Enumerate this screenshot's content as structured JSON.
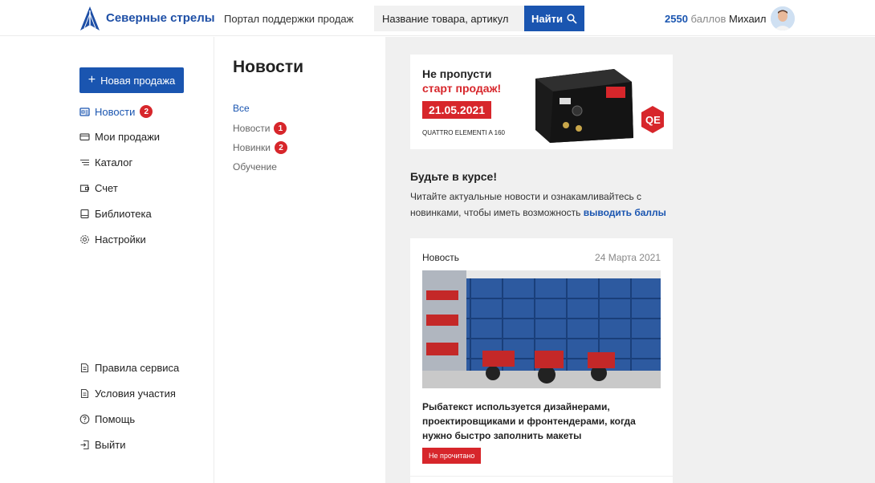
{
  "header": {
    "brand": "Северные стрелы",
    "tagline": "Портал поддержки продаж",
    "search_placeholder": "Название товара, артикул",
    "search_button": "Найти",
    "points_value": "2550",
    "points_label": "баллов",
    "user_name": "Михаил"
  },
  "sidebar": {
    "new_sale": "Новая продажа",
    "items": [
      {
        "label": "Новости",
        "badge": "2",
        "icon": "newspaper-icon"
      },
      {
        "label": "Мои продажи",
        "icon": "card-icon"
      },
      {
        "label": "Каталог",
        "icon": "list-icon"
      },
      {
        "label": "Счет",
        "icon": "wallet-icon"
      },
      {
        "label": "Библиотека",
        "icon": "book-icon"
      },
      {
        "label": "Настройки",
        "icon": "gear-icon"
      }
    ],
    "bottom_items": [
      {
        "label": "Правила сервиса",
        "icon": "document-icon"
      },
      {
        "label": "Условия участия",
        "icon": "document-icon"
      },
      {
        "label": "Помощь",
        "icon": "help-icon"
      },
      {
        "label": "Выйти",
        "icon": "logout-icon"
      }
    ]
  },
  "middle": {
    "title": "Новости",
    "filters": [
      {
        "label": "Все"
      },
      {
        "label": "Новости",
        "badge": "1"
      },
      {
        "label": "Новинки",
        "badge": "2"
      },
      {
        "label": "Обучение"
      }
    ]
  },
  "banner": {
    "line1": "Не пропусти",
    "line2": "старт продаж!",
    "date": "21.05.2021",
    "model": "QUATTRO ELEMENTI A 160"
  },
  "info": {
    "title": "Будьте в курсе!",
    "text": "Читайте актуальные новости и ознакамливайтесь с новинками, чтобы иметь возможность",
    "link": "выводить баллы"
  },
  "news_card": {
    "category": "Новость",
    "date": "24 Марта 2021",
    "text": "Рыбатекст используется дизайнерами, проектировщиками и фронтендерами, когда нужно быстро заполнить макеты",
    "status": "Не прочитано"
  },
  "colors": {
    "accent": "#1a55b0",
    "badge": "#d7262b",
    "content_bg": "#f0f0f0"
  }
}
